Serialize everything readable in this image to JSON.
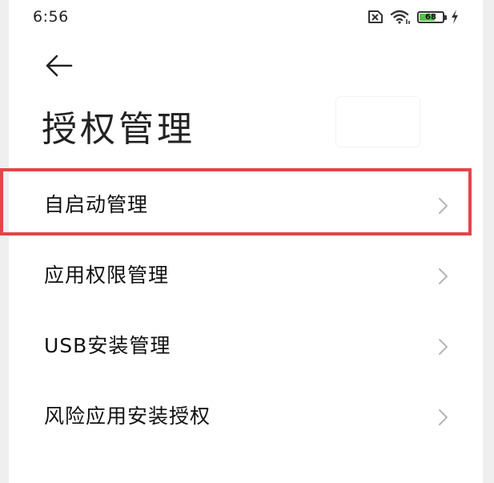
{
  "status_bar": {
    "time": "6:56",
    "battery_level": "68",
    "battery_fraction": 0.68,
    "icons": [
      "sim-card-error-icon",
      "wifi-icon",
      "battery-icon",
      "charging-icon"
    ]
  },
  "header": {
    "back_icon": "arrow-left-icon",
    "title": "授权管理"
  },
  "menu": {
    "items": [
      {
        "label": "自启动管理",
        "icon": "chevron-right-icon",
        "highlighted": true
      },
      {
        "label": "应用权限管理",
        "icon": "chevron-right-icon"
      },
      {
        "label": "USB安装管理",
        "icon": "chevron-right-icon"
      },
      {
        "label": "风险应用安装授权",
        "icon": "chevron-right-icon"
      }
    ]
  },
  "colors": {
    "highlight": "#e0464a",
    "battery_fill": "#57c24a"
  }
}
